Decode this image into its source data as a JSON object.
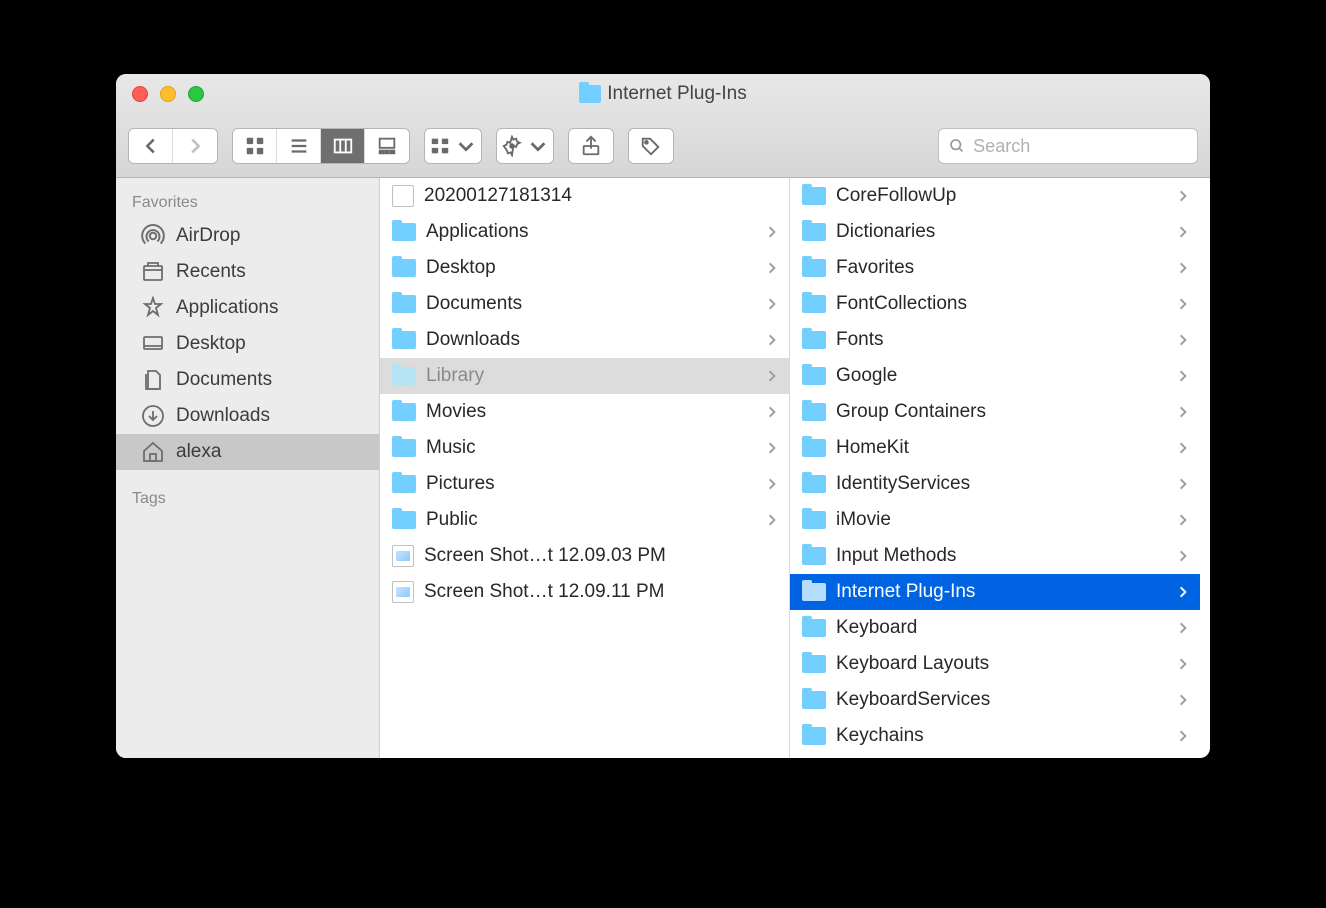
{
  "title": "Internet Plug-Ins",
  "search_placeholder": "Search",
  "sidebar": {
    "favorites_header": "Favorites",
    "tags_header": "Tags",
    "items": [
      {
        "label": "AirDrop",
        "icon": "airdrop"
      },
      {
        "label": "Recents",
        "icon": "recents"
      },
      {
        "label": "Applications",
        "icon": "applications"
      },
      {
        "label": "Desktop",
        "icon": "desktop"
      },
      {
        "label": "Documents",
        "icon": "documents"
      },
      {
        "label": "Downloads",
        "icon": "downloads"
      },
      {
        "label": "alexa",
        "icon": "home",
        "selected": true
      }
    ]
  },
  "columns": [
    {
      "items": [
        {
          "name": "20200127181314",
          "type": "file"
        },
        {
          "name": "Applications",
          "type": "folder"
        },
        {
          "name": "Desktop",
          "type": "folder"
        },
        {
          "name": "Documents",
          "type": "folder"
        },
        {
          "name": "Downloads",
          "type": "folder"
        },
        {
          "name": "Library",
          "type": "folder",
          "state": "dim-selected"
        },
        {
          "name": "Movies",
          "type": "folder"
        },
        {
          "name": "Music",
          "type": "folder"
        },
        {
          "name": "Pictures",
          "type": "folder"
        },
        {
          "name": "Public",
          "type": "folder"
        },
        {
          "name": "Screen Shot…t 12.09.03 PM",
          "type": "file-img"
        },
        {
          "name": "Screen Shot…t 12.09.11 PM",
          "type": "file-img"
        }
      ]
    },
    {
      "items": [
        {
          "name": "CoreFollowUp",
          "type": "folder"
        },
        {
          "name": "Dictionaries",
          "type": "folder"
        },
        {
          "name": "Favorites",
          "type": "folder"
        },
        {
          "name": "FontCollections",
          "type": "folder"
        },
        {
          "name": "Fonts",
          "type": "folder"
        },
        {
          "name": "Google",
          "type": "folder"
        },
        {
          "name": "Group Containers",
          "type": "folder"
        },
        {
          "name": "HomeKit",
          "type": "folder"
        },
        {
          "name": "IdentityServices",
          "type": "folder"
        },
        {
          "name": "iMovie",
          "type": "folder"
        },
        {
          "name": "Input Methods",
          "type": "folder"
        },
        {
          "name": "Internet Plug-Ins",
          "type": "folder",
          "state": "active-selected"
        },
        {
          "name": "Keyboard",
          "type": "folder"
        },
        {
          "name": "Keyboard Layouts",
          "type": "folder"
        },
        {
          "name": "KeyboardServices",
          "type": "folder"
        },
        {
          "name": "Keychains",
          "type": "folder"
        }
      ]
    }
  ]
}
